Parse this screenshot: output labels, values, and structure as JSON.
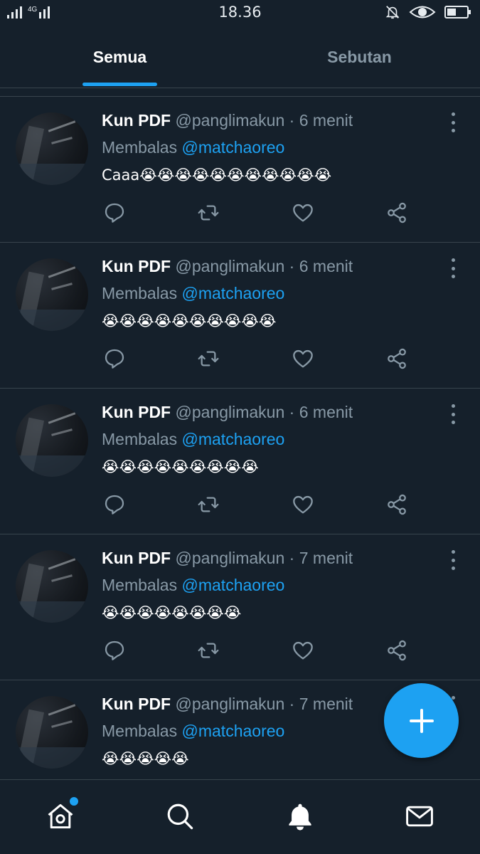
{
  "status_bar": {
    "network": "4G",
    "time": "18.36"
  },
  "tabs": [
    {
      "label": "Semua",
      "active": true
    },
    {
      "label": "Sebutan",
      "active": false
    }
  ],
  "reply_prefix": "Membalas",
  "tweets": [
    {
      "name": "Kun PDF",
      "handle": "@panglimakun",
      "separator": "·",
      "time": "6 menit",
      "reply_to": "@matchaoreo",
      "text": "Caaa😭😭😭😭😭😭😭😭😭😭😭"
    },
    {
      "name": "Kun PDF",
      "handle": "@panglimakun",
      "separator": "·",
      "time": "6 menit",
      "reply_to": "@matchaoreo",
      "text": "😭😭😭😭😭😭😭😭😭😭"
    },
    {
      "name": "Kun PDF",
      "handle": "@panglimakun",
      "separator": "·",
      "time": "6 menit",
      "reply_to": "@matchaoreo",
      "text": "😭😭😭😭😭😭😭😭😭"
    },
    {
      "name": "Kun PDF",
      "handle": "@panglimakun",
      "separator": "·",
      "time": "7 menit",
      "reply_to": "@matchaoreo",
      "text": "😭😭😭😭😭😭😭😭"
    },
    {
      "name": "Kun PDF",
      "handle": "@panglimakun",
      "separator": "·",
      "time": "7 menit",
      "reply_to": "@matchaoreo",
      "text": "😭😭😭😭😭"
    }
  ],
  "colors": {
    "background": "#15202b",
    "accent": "#1da1f2",
    "muted": "#8899a6",
    "divider": "#38444d"
  },
  "icons": {
    "reply": "reply-icon",
    "retweet": "retweet-icon",
    "like": "heart-icon",
    "share": "share-icon",
    "more": "more-vertical-icon",
    "compose": "plus-icon",
    "nav": [
      "home-icon",
      "search-icon",
      "bell-icon",
      "mail-icon"
    ]
  }
}
